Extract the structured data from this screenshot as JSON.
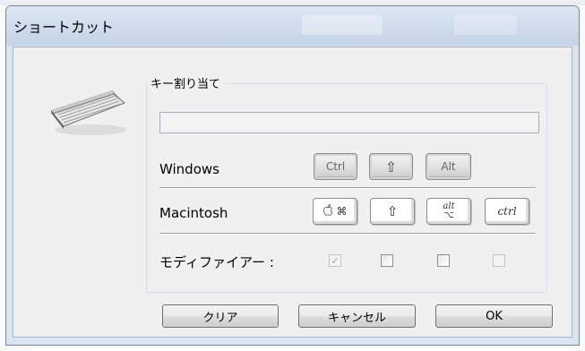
{
  "dialog": {
    "title": "ショートカット"
  },
  "icon": {
    "keyboard": "keyboard-icon"
  },
  "group": {
    "label": "キー割り当て",
    "shortcut_value": ""
  },
  "rows": {
    "windows": {
      "label": "Windows",
      "keys": [
        "Ctrl",
        "⇧",
        "Alt"
      ]
    },
    "mac": {
      "label": "Macintosh",
      "keys": [
        "⌘",
        "⇧",
        "alt",
        "ctrl"
      ],
      "command_apple": "",
      "command_symbol": "⌘",
      "alt_top": "alt",
      "alt_bottom": "⌥"
    },
    "modifier": {
      "label": "モディファイアー :",
      "checkboxes": [
        {
          "checked": true,
          "enabled": false
        },
        {
          "checked": false,
          "enabled": true
        },
        {
          "checked": false,
          "enabled": true
        },
        {
          "checked": false,
          "enabled": false
        }
      ]
    }
  },
  "buttons": {
    "clear": "クリア",
    "cancel": "キャンセル",
    "ok": "OK"
  },
  "colors": {
    "title_bar": "#cfdcec",
    "client_bg": "#f0f0f0"
  }
}
